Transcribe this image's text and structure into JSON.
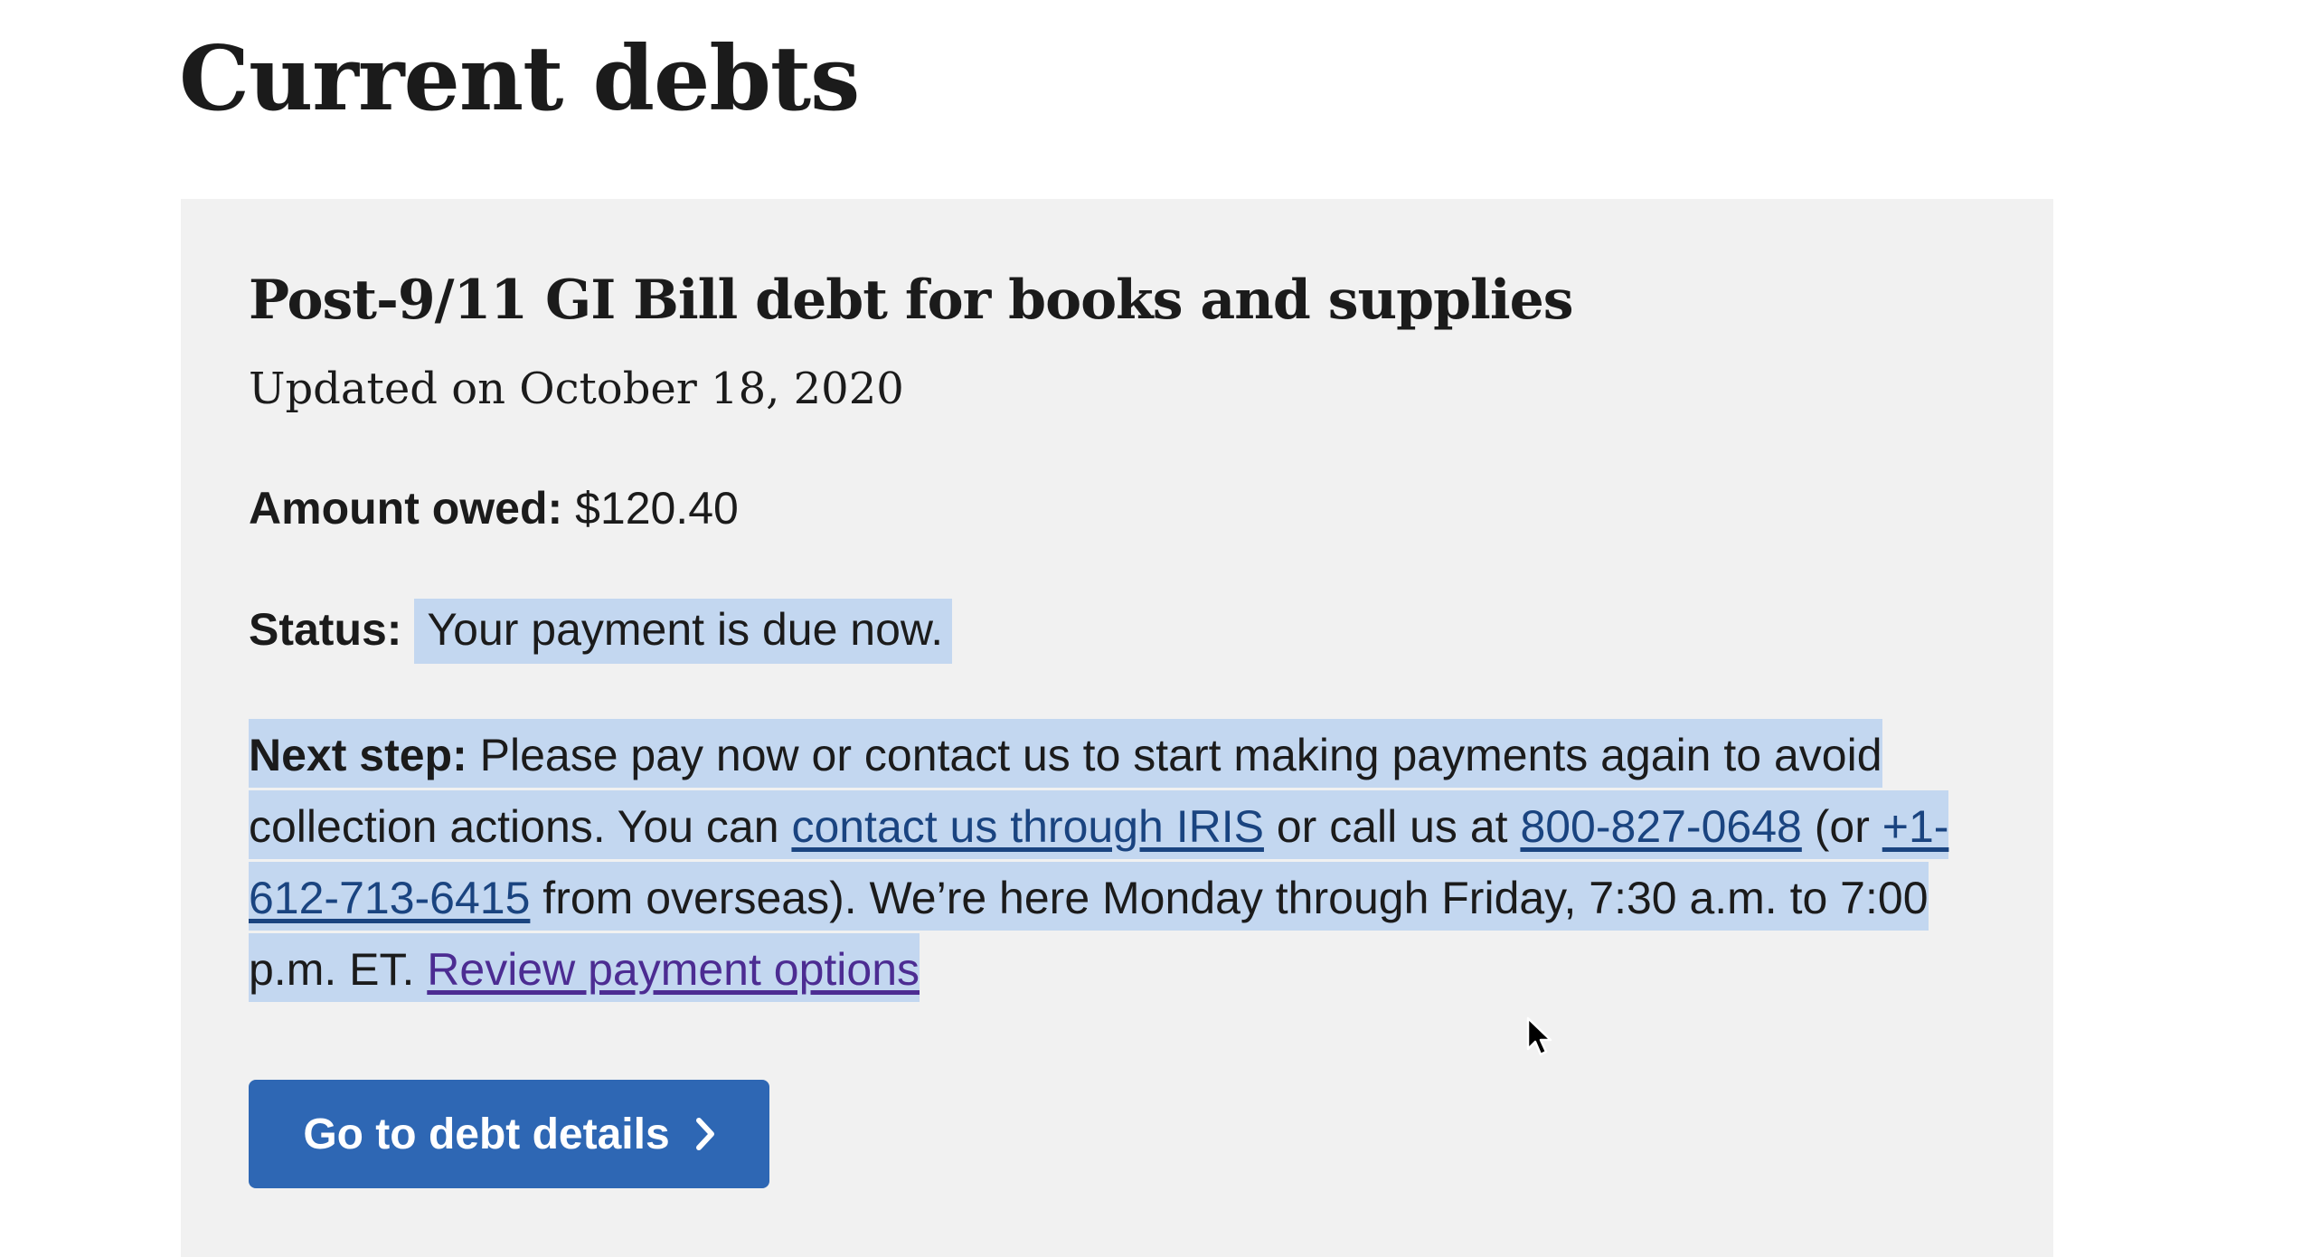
{
  "page": {
    "title": "Current debts"
  },
  "debt_card": {
    "title": "Post-9/11 GI Bill debt for books and supplies",
    "updated": "Updated on October 18, 2020",
    "amount_label": "Amount owed:",
    "amount_value": "$120.40",
    "status_label": "Status:",
    "status_value": "Your payment is due now.",
    "next_step": {
      "label": "Next step:",
      "text_1": "Please pay now or contact us to start making payments again to avoid collection actions. You can",
      "link_iris": "contact us through IRIS",
      "text_2": "or call us at",
      "link_phone": "800-827-0648",
      "text_3": "(or",
      "link_overseas_phone": "+1-612-713-6415",
      "text_4": "from overseas). We’re here Monday through Friday, 7:30 a.m. to 7:00 p.m. ET.",
      "link_payment_options": "Review payment options"
    },
    "button_label": "Go to debt details",
    "button_icon": "chevron-right-icon"
  },
  "colors": {
    "card_background": "#f1f1f1",
    "button_background": "#2e67b4",
    "link": "#1a4480",
    "visited_link": "#4c2c92",
    "selection_highlight": "#c3d7f0",
    "text": "#1b1b1b"
  }
}
